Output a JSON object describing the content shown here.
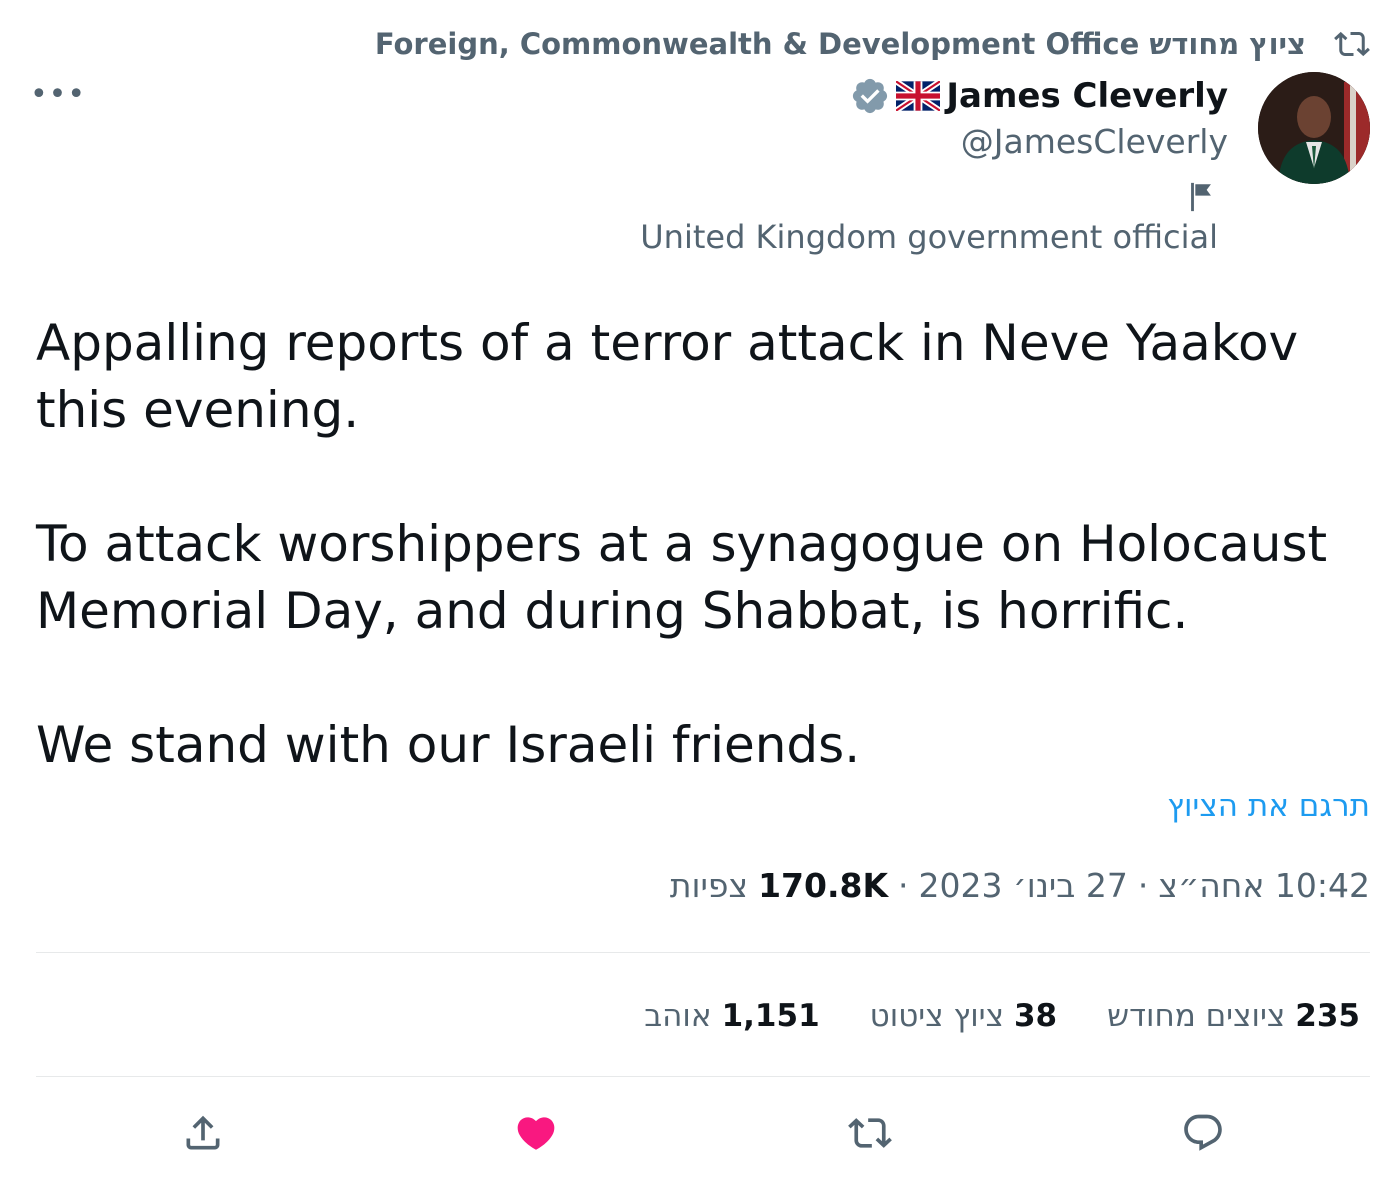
{
  "retweet_context": {
    "text": "ציוץ מחודש Foreign, Commonwealth & Development Office",
    "icon": "retweet-icon"
  },
  "more_icon": "more-icon",
  "author": {
    "name": "James Cleverly",
    "handle": "@JamesCleverly",
    "flag_emoji": "uk-flag-icon",
    "verified_icon": "verified-badge-icon",
    "affiliation_icon": "flag-icon",
    "affiliation_label": "United Kingdom government official"
  },
  "tweet": {
    "paragraphs": [
      "Appalling reports of a terror attack in Neve Yaakov this evening.",
      "To attack worshippers at a synagogue on Holocaust Memorial Day, and during Shabbat, is horrific.",
      "We stand with our Israeli friends."
    ],
    "translate_label": "תרגם את הציוץ"
  },
  "meta": {
    "time": "10:42 אחה״צ",
    "sep1": "·",
    "date": "27 בינו׳ 2023",
    "sep2": "·",
    "views_count": "170.8K",
    "views_label": "צפיות"
  },
  "stats": {
    "retweets_count": "235",
    "retweets_label": "ציוצים מחודש",
    "quotes_count": "38",
    "quotes_label": "ציוץ ציטוט",
    "likes_count": "1,151",
    "likes_label": "אוהב"
  },
  "actions": {
    "reply_icon": "reply-icon",
    "retweet_icon": "retweet-icon",
    "like_icon": "heart-icon",
    "share_icon": "share-icon",
    "like_color": "#f91880"
  },
  "colors": {
    "text": "#0f1419",
    "secondary": "#536471",
    "link": "#1d9bf0",
    "divider": "#e7e9ea"
  }
}
